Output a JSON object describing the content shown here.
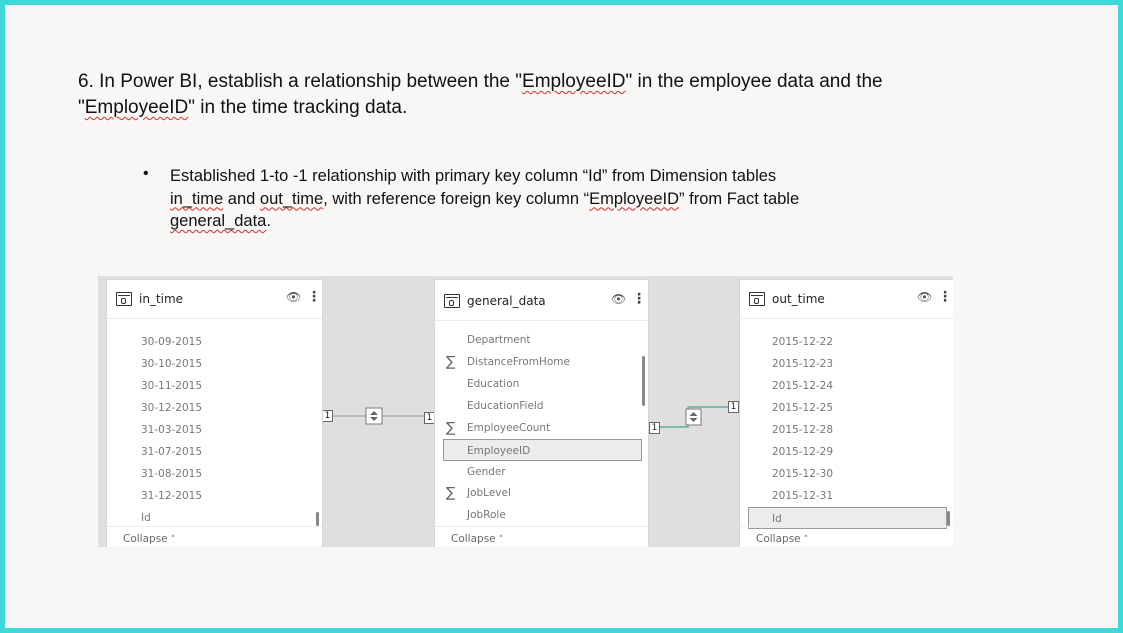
{
  "heading": {
    "part1": "6. In Power BI, establish a relationship between the \"",
    "emp1": "EmployeeID",
    "part2": "\" in the employee data and the",
    "part3": "\"",
    "emp2": "EmployeeID",
    "part4": "\" in the time tracking data."
  },
  "bullet": {
    "symbol": "•",
    "line1": "Established 1-to -1 relationship with primary key column “Id” from Dimension tables",
    "in_time": "in_time",
    "and": " and ",
    "out_time": "out_time",
    "mid": ", with reference foreign key column “",
    "emp": "EmployeeID",
    "end": "” from Fact table",
    "general": "general_data",
    "period": "."
  },
  "tables": {
    "in_time": {
      "title": "in_time",
      "icon": "table-icon",
      "rows": [
        "30-09-2015",
        "30-10-2015",
        "30-11-2015",
        "30-12-2015",
        "31-03-2015",
        "31-07-2015",
        "31-08-2015",
        "31-12-2015",
        "Id"
      ],
      "collapse": "Collapse"
    },
    "general_data": {
      "title": "general_data",
      "icon": "table-icon",
      "rows": [
        "Department",
        "DistanceFromHome",
        "Education",
        "EducationField",
        "EmployeeCount",
        "EmployeeID",
        "Gender",
        "JobLevel",
        "JobRole"
      ],
      "sigma_rows": [
        "DistanceFromHome",
        "EmployeeCount",
        "JobLevel"
      ],
      "selected": "EmployeeID",
      "collapse": "Collapse"
    },
    "out_time": {
      "title": "out_time",
      "icon": "table-icon",
      "rows": [
        "2015-12-22",
        "2015-12-23",
        "2015-12-24",
        "2015-12-25",
        "2015-12-28",
        "2015-12-29",
        "2015-12-30",
        "2015-12-31",
        "Id"
      ],
      "selected": "Id",
      "collapse": "Collapse"
    }
  },
  "relationships": {
    "left": {
      "from_card": "1",
      "to_card": "1"
    },
    "right": {
      "from_card": "1",
      "to_card": "1"
    }
  },
  "icons": {
    "eye": "eye-icon",
    "more": "more-options-icon",
    "sigma": "sum-icon",
    "chevron": "chevron-up-icon",
    "arrows": "bidirectional-filter-icon"
  }
}
